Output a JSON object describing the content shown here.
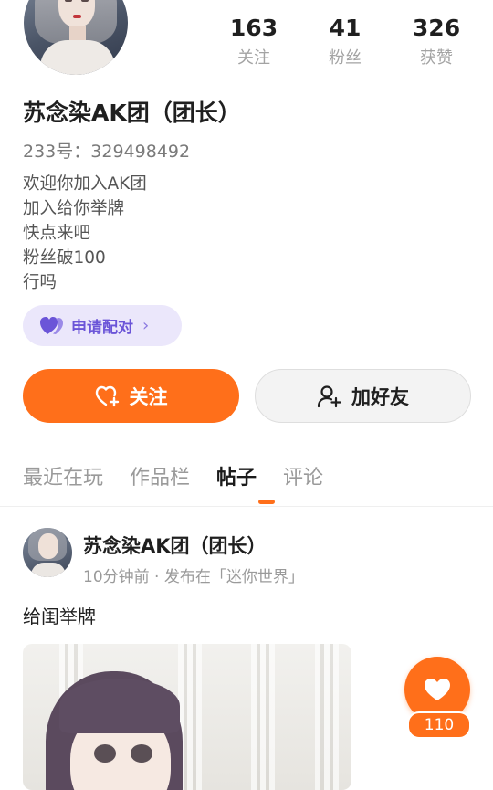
{
  "profile": {
    "name": "苏念染AK团（团长）",
    "id_text": "233号：329498492",
    "bio": [
      "欢迎你加入AK团",
      "加入给你举牌",
      "快点来吧",
      "粉丝破100",
      "行吗"
    ]
  },
  "stats": [
    {
      "value": "163",
      "label": "关注"
    },
    {
      "value": "41",
      "label": "粉丝"
    },
    {
      "value": "326",
      "label": "获赞"
    }
  ],
  "pair_button": {
    "label": "申请配对",
    "icon": "double-heart-icon",
    "chevron": "›"
  },
  "actions": {
    "follow_label": "关注",
    "add_friend_label": "加好友",
    "follow_color": "#ff6f1a"
  },
  "tabs": [
    {
      "label": "最近在玩",
      "active": false
    },
    {
      "label": "作品栏",
      "active": false
    },
    {
      "label": "帖子",
      "active": true
    },
    {
      "label": "评论",
      "active": false
    }
  ],
  "post": {
    "author": "苏念染AK团（团长）",
    "meta": "10分钟前 · 发布在「迷你世界」",
    "text": "给闺举牌",
    "like_count": "110"
  },
  "colors": {
    "accent": "#ff6f1a",
    "pair_bg": "#ebe7fb",
    "pair_text": "#6b55d8"
  }
}
